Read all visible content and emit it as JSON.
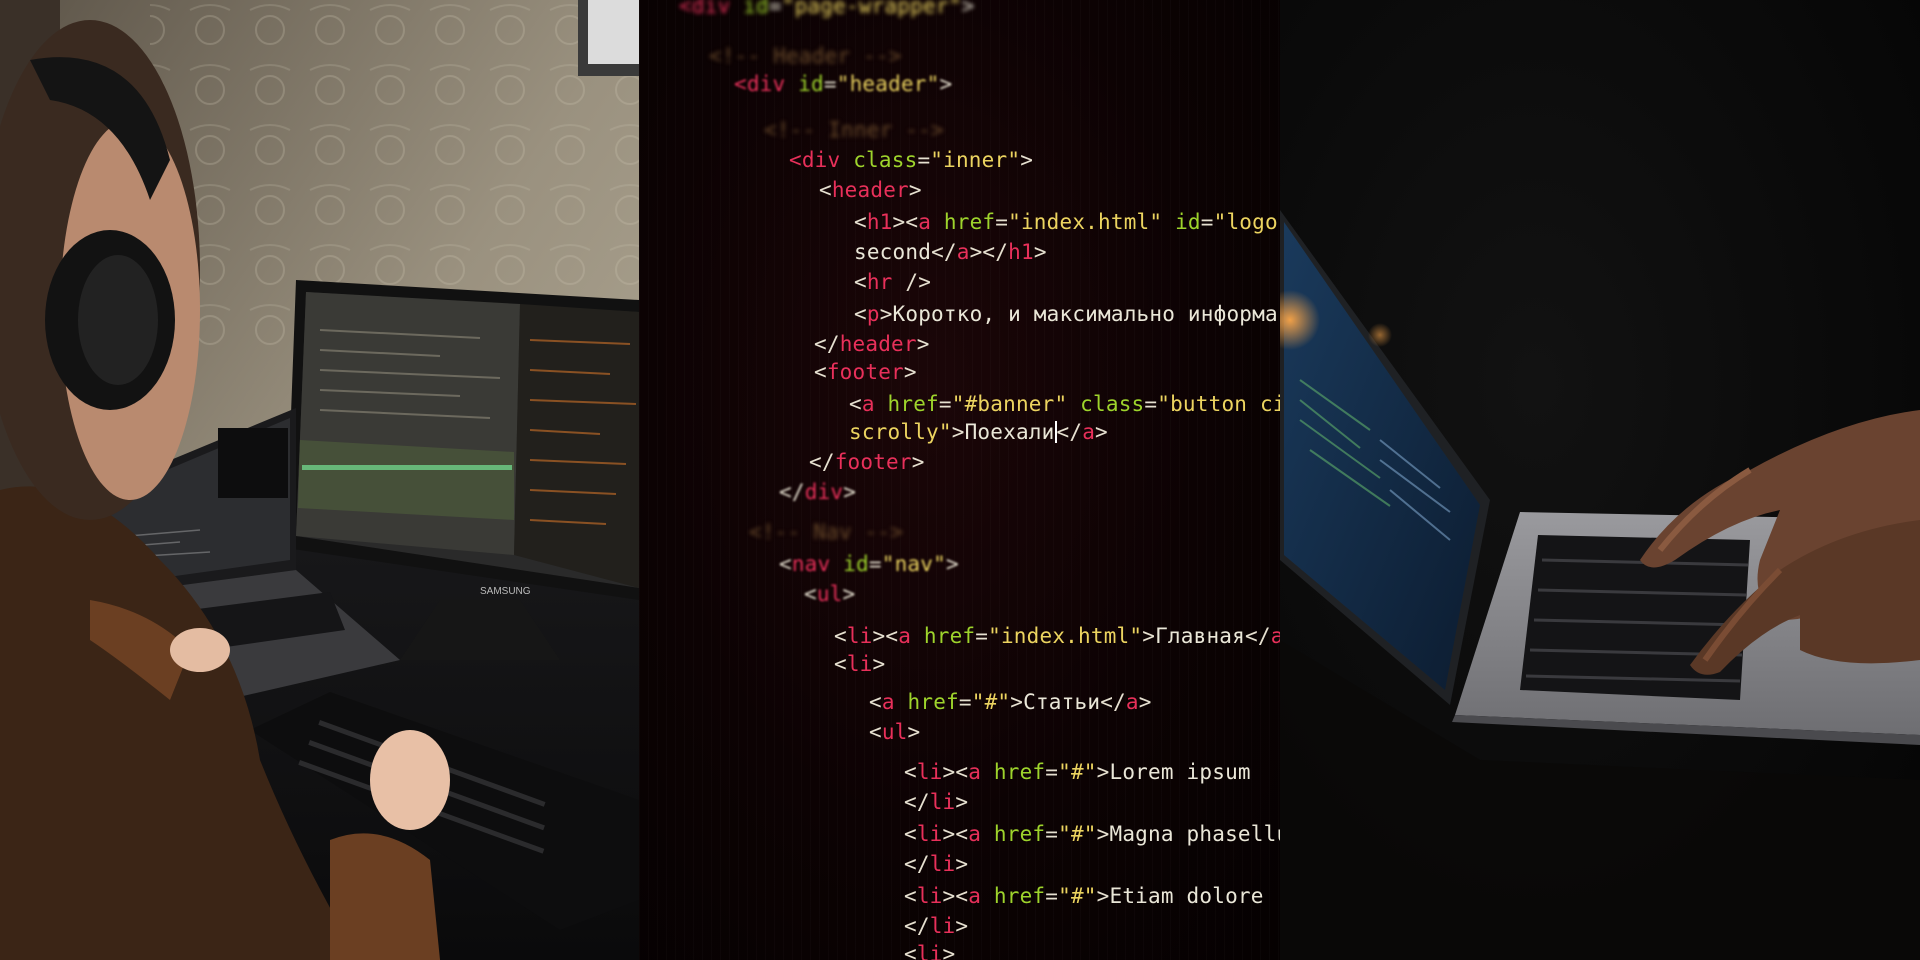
{
  "panels": [
    {
      "name": "developer-at-desk-photo"
    },
    {
      "name": "html-code-closeup-photo"
    },
    {
      "name": "hands-typing-laptop-photo"
    }
  ],
  "colors": {
    "tag": "#e8305a",
    "attribute": "#9ed42c",
    "string": "#ecd460",
    "text": "#eae7d8",
    "comment": "#6a4a2a"
  },
  "monitor_brand": "SAMSUNG",
  "code_lines": [
    {
      "blur": 2,
      "tokens": [
        [
          "tag",
          "<div"
        ],
        [
          "attr",
          " id"
        ],
        [
          "pun",
          "="
        ],
        [
          "str",
          "\"page-wrapper\""
        ],
        [
          "pun",
          ">"
        ]
      ]
    },
    {
      "blur": 2,
      "tokens": [
        [
          "com",
          "<!-- Header -->"
        ]
      ]
    },
    {
      "blur": 1,
      "tokens": [
        [
          "tag",
          "<div"
        ],
        [
          "attr",
          " id"
        ],
        [
          "pun",
          "="
        ],
        [
          "str",
          "\"header\""
        ],
        [
          "pun",
          ">"
        ]
      ]
    },
    {
      "blur": 2,
      "tokens": [
        [
          "com",
          "<!-- Inner -->"
        ]
      ]
    },
    {
      "blur": 0,
      "tokens": [
        [
          "tag",
          "<div"
        ],
        [
          "attr",
          " class"
        ],
        [
          "pun",
          "="
        ],
        [
          "str",
          "\"inner\""
        ],
        [
          "pun",
          ">"
        ]
      ]
    },
    {
      "blur": 0,
      "tokens": [
        [
          "pun",
          "<"
        ],
        [
          "tag",
          "header"
        ],
        [
          "pun",
          ">"
        ]
      ]
    },
    {
      "blur": 0,
      "tokens": [
        [
          "pun",
          "<"
        ],
        [
          "tag",
          "h1"
        ],
        [
          "pun",
          "><"
        ],
        [
          "tag",
          "a"
        ],
        [
          "attr",
          " href"
        ],
        [
          "pun",
          "="
        ],
        [
          "str",
          "\"index.html\""
        ],
        [
          "attr",
          " id"
        ],
        [
          "pun",
          "="
        ],
        [
          "str",
          "\"logo\""
        ],
        [
          "pun",
          ">"
        ]
      ]
    },
    {
      "blur": 0,
      "tokens": [
        [
          "txt",
          "second"
        ],
        [
          "pun",
          "</"
        ],
        [
          "tag",
          "a"
        ],
        [
          "pun",
          "></"
        ],
        [
          "tag",
          "h1"
        ],
        [
          "pun",
          ">"
        ]
      ]
    },
    {
      "blur": 0,
      "tokens": [
        [
          "pun",
          "<"
        ],
        [
          "tag",
          "hr"
        ],
        [
          "pun",
          " />"
        ]
      ]
    },
    {
      "blur": 0,
      "tokens": [
        [
          "pun",
          "<"
        ],
        [
          "tag",
          "p"
        ],
        [
          "pun",
          ">"
        ],
        [
          "txt",
          "Коротко, и максимально информативно"
        ]
      ]
    },
    {
      "blur": 0,
      "tokens": [
        [
          "pun",
          "</"
        ],
        [
          "tag",
          "header"
        ],
        [
          "pun",
          ">"
        ]
      ]
    },
    {
      "blur": 0,
      "tokens": [
        [
          "pun",
          "<"
        ],
        [
          "tag",
          "footer"
        ],
        [
          "pun",
          ">"
        ]
      ]
    },
    {
      "blur": 0,
      "tokens": [
        [
          "pun",
          "<"
        ],
        [
          "tag",
          "a"
        ],
        [
          "attr",
          " href"
        ],
        [
          "pun",
          "="
        ],
        [
          "str",
          "\"#banner\""
        ],
        [
          "attr",
          " class"
        ],
        [
          "pun",
          "="
        ],
        [
          "str",
          "\"button circled"
        ]
      ]
    },
    {
      "blur": 0,
      "tokens": [
        [
          "str",
          "scrolly\""
        ],
        [
          "pun",
          ">"
        ],
        [
          "txt",
          "Поехали"
        ],
        [
          "cur",
          ""
        ],
        [
          "pun",
          "</"
        ],
        [
          "tag",
          "a"
        ],
        [
          "pun",
          ">"
        ]
      ]
    },
    {
      "blur": 0,
      "tokens": [
        [
          "pun",
          "</"
        ],
        [
          "tag",
          "footer"
        ],
        [
          "pun",
          ">"
        ]
      ]
    },
    {
      "blur": 1,
      "tokens": [
        [
          "pun",
          "</"
        ],
        [
          "tag",
          "div"
        ],
        [
          "pun",
          ">"
        ]
      ]
    },
    {
      "blur": 2,
      "tokens": [
        [
          "com",
          "<!-- Nav -->"
        ]
      ]
    },
    {
      "blur": 1,
      "tokens": [
        [
          "pun",
          "<"
        ],
        [
          "tag",
          "nav"
        ],
        [
          "attr",
          " id"
        ],
        [
          "pun",
          "="
        ],
        [
          "str",
          "\"nav\""
        ],
        [
          "pun",
          ">"
        ]
      ]
    },
    {
      "blur": 1,
      "tokens": [
        [
          "pun",
          "<"
        ],
        [
          "tag",
          "ul"
        ],
        [
          "pun",
          ">"
        ]
      ]
    },
    {
      "blur": 0,
      "tokens": [
        [
          "pun",
          "<"
        ],
        [
          "tag",
          "li"
        ],
        [
          "pun",
          "><"
        ],
        [
          "tag",
          "a"
        ],
        [
          "attr",
          " href"
        ],
        [
          "pun",
          "="
        ],
        [
          "str",
          "\"index.html\""
        ],
        [
          "pun",
          ">"
        ],
        [
          "txt",
          "Главная"
        ],
        [
          "pun",
          "</"
        ],
        [
          "tag",
          "a"
        ],
        [
          "pun",
          ">"
        ]
      ]
    },
    {
      "blur": 0,
      "tokens": [
        [
          "pun",
          "<"
        ],
        [
          "tag",
          "li"
        ],
        [
          "pun",
          ">"
        ]
      ]
    },
    {
      "blur": 0,
      "tokens": [
        [
          "pun",
          "<"
        ],
        [
          "tag",
          "a"
        ],
        [
          "attr",
          " href"
        ],
        [
          "pun",
          "="
        ],
        [
          "str",
          "\"#\""
        ],
        [
          "pun",
          ">"
        ],
        [
          "txt",
          "Статьи"
        ],
        [
          "pun",
          "</"
        ],
        [
          "tag",
          "a"
        ],
        [
          "pun",
          ">"
        ]
      ]
    },
    {
      "blur": 0,
      "tokens": [
        [
          "pun",
          "<"
        ],
        [
          "tag",
          "ul"
        ],
        [
          "pun",
          ">"
        ]
      ]
    },
    {
      "blur": 0,
      "tokens": [
        [
          "pun",
          "<"
        ],
        [
          "tag",
          "li"
        ],
        [
          "pun",
          "><"
        ],
        [
          "tag",
          "a"
        ],
        [
          "attr",
          " href"
        ],
        [
          "pun",
          "="
        ],
        [
          "str",
          "\"#\""
        ],
        [
          "pun",
          ">"
        ],
        [
          "txt",
          "Lorem ipsum"
        ]
      ]
    },
    {
      "blur": 0,
      "tokens": [
        [
          "pun",
          "</"
        ],
        [
          "tag",
          "li"
        ],
        [
          "pun",
          ">"
        ]
      ]
    },
    {
      "blur": 0,
      "tokens": [
        [
          "pun",
          "<"
        ],
        [
          "tag",
          "li"
        ],
        [
          "pun",
          "><"
        ],
        [
          "tag",
          "a"
        ],
        [
          "attr",
          " href"
        ],
        [
          "pun",
          "="
        ],
        [
          "str",
          "\"#\""
        ],
        [
          "pun",
          ">"
        ],
        [
          "txt",
          "Magna phasellus"
        ]
      ]
    },
    {
      "blur": 0,
      "tokens": [
        [
          "pun",
          "</"
        ],
        [
          "tag",
          "li"
        ],
        [
          "pun",
          ">"
        ]
      ]
    },
    {
      "blur": 0,
      "tokens": [
        [
          "pun",
          "<"
        ],
        [
          "tag",
          "li"
        ],
        [
          "pun",
          "><"
        ],
        [
          "tag",
          "a"
        ],
        [
          "attr",
          " href"
        ],
        [
          "pun",
          "="
        ],
        [
          "str",
          "\"#\""
        ],
        [
          "pun",
          ">"
        ],
        [
          "txt",
          "Etiam dolore"
        ]
      ]
    },
    {
      "blur": 0,
      "tokens": [
        [
          "pun",
          "</"
        ],
        [
          "tag",
          "li"
        ],
        [
          "pun",
          ">"
        ]
      ]
    },
    {
      "blur": 0,
      "tokens": [
        [
          "pun",
          "<"
        ],
        [
          "tag",
          "li"
        ],
        [
          "pun",
          ">"
        ]
      ]
    }
  ]
}
